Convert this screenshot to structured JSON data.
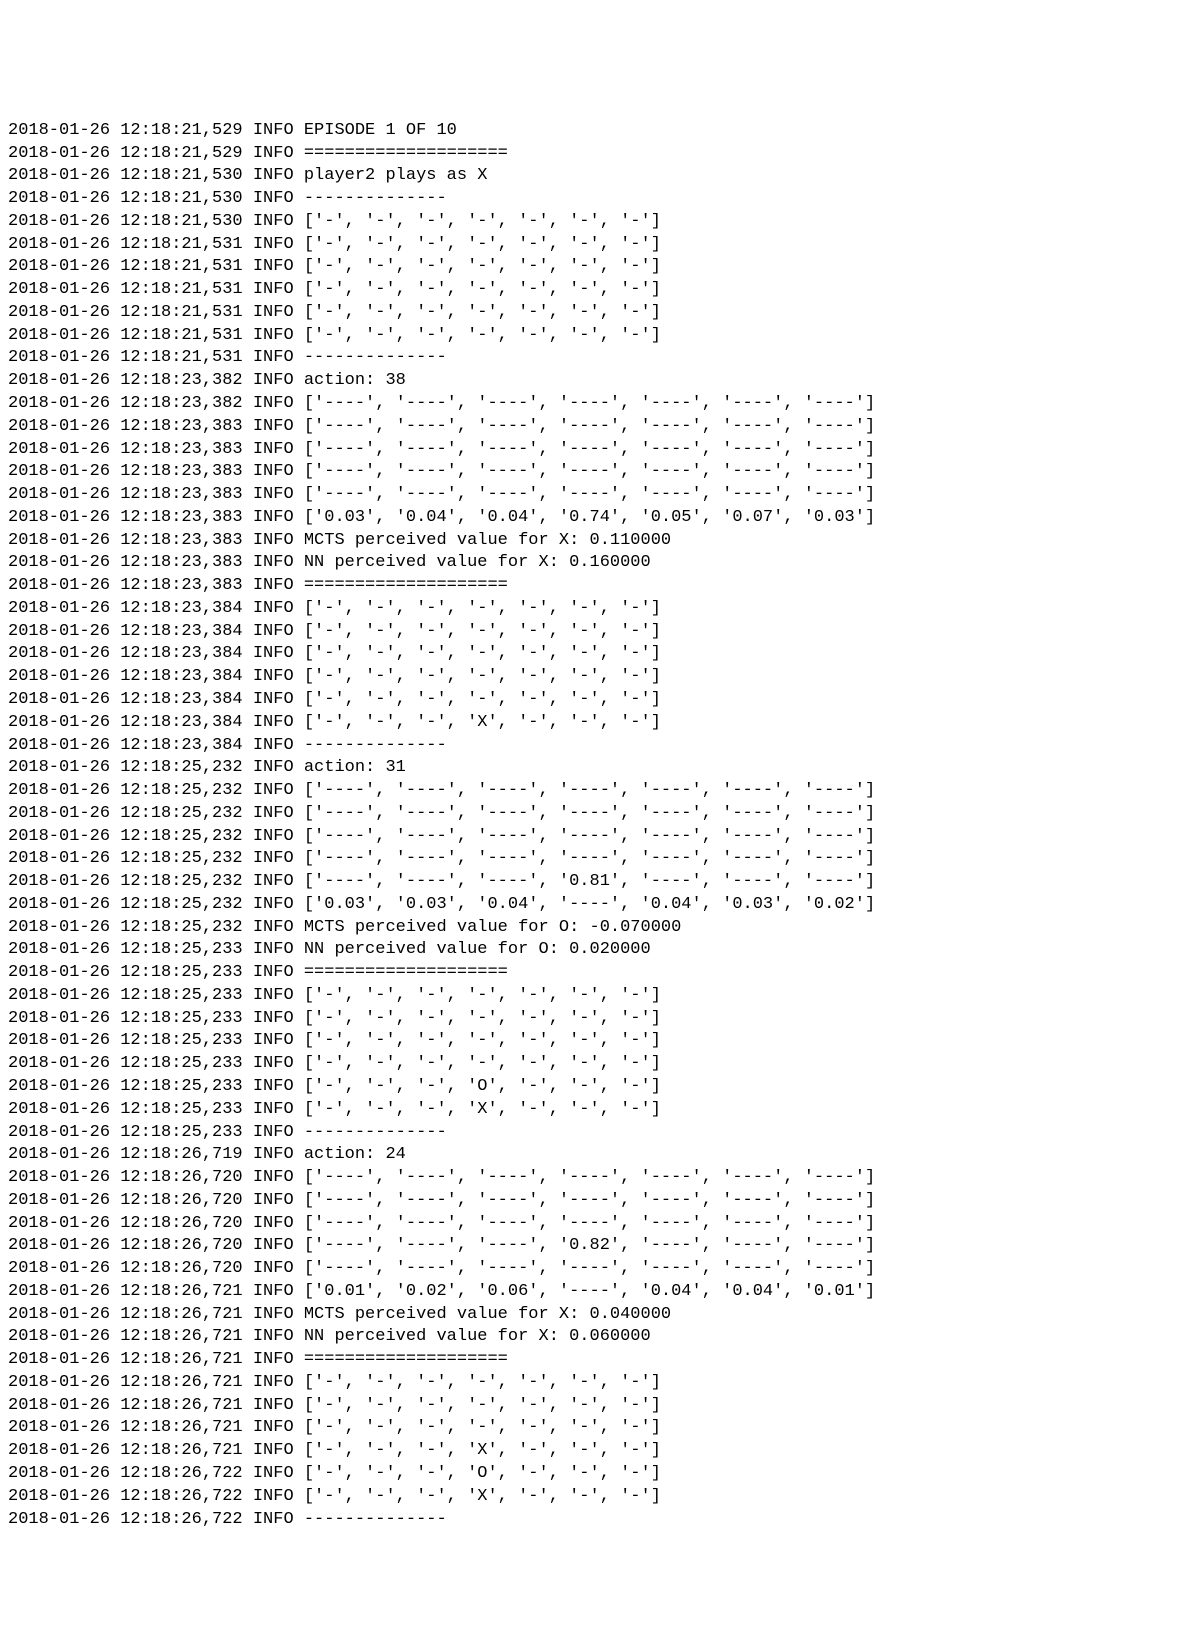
{
  "lines": [
    {
      "ts": "2018-01-26 12:18:21,529",
      "lvl": "INFO",
      "msg": "EPISODE 1 OF 10"
    },
    {
      "ts": "2018-01-26 12:18:21,529",
      "lvl": "INFO",
      "msg": "===================="
    },
    {
      "ts": "2018-01-26 12:18:21,530",
      "lvl": "INFO",
      "msg": "player2 plays as X"
    },
    {
      "ts": "2018-01-26 12:18:21,530",
      "lvl": "INFO",
      "msg": "--------------"
    },
    {
      "ts": "2018-01-26 12:18:21,530",
      "lvl": "INFO",
      "msg": "['-', '-', '-', '-', '-', '-', '-']"
    },
    {
      "ts": "2018-01-26 12:18:21,531",
      "lvl": "INFO",
      "msg": "['-', '-', '-', '-', '-', '-', '-']"
    },
    {
      "ts": "2018-01-26 12:18:21,531",
      "lvl": "INFO",
      "msg": "['-', '-', '-', '-', '-', '-', '-']"
    },
    {
      "ts": "2018-01-26 12:18:21,531",
      "lvl": "INFO",
      "msg": "['-', '-', '-', '-', '-', '-', '-']"
    },
    {
      "ts": "2018-01-26 12:18:21,531",
      "lvl": "INFO",
      "msg": "['-', '-', '-', '-', '-', '-', '-']"
    },
    {
      "ts": "2018-01-26 12:18:21,531",
      "lvl": "INFO",
      "msg": "['-', '-', '-', '-', '-', '-', '-']"
    },
    {
      "ts": "2018-01-26 12:18:21,531",
      "lvl": "INFO",
      "msg": "--------------"
    },
    {
      "ts": "2018-01-26 12:18:23,382",
      "lvl": "INFO",
      "msg": "action: 38"
    },
    {
      "ts": "2018-01-26 12:18:23,382",
      "lvl": "INFO",
      "msg": "['----', '----', '----', '----', '----', '----', '----']"
    },
    {
      "ts": "2018-01-26 12:18:23,383",
      "lvl": "INFO",
      "msg": "['----', '----', '----', '----', '----', '----', '----']"
    },
    {
      "ts": "2018-01-26 12:18:23,383",
      "lvl": "INFO",
      "msg": "['----', '----', '----', '----', '----', '----', '----']"
    },
    {
      "ts": "2018-01-26 12:18:23,383",
      "lvl": "INFO",
      "msg": "['----', '----', '----', '----', '----', '----', '----']"
    },
    {
      "ts": "2018-01-26 12:18:23,383",
      "lvl": "INFO",
      "msg": "['----', '----', '----', '----', '----', '----', '----']"
    },
    {
      "ts": "2018-01-26 12:18:23,383",
      "lvl": "INFO",
      "msg": "['0.03', '0.04', '0.04', '0.74', '0.05', '0.07', '0.03']"
    },
    {
      "ts": "2018-01-26 12:18:23,383",
      "lvl": "INFO",
      "msg": "MCTS perceived value for X: 0.110000"
    },
    {
      "ts": "2018-01-26 12:18:23,383",
      "lvl": "INFO",
      "msg": "NN perceived value for X: 0.160000"
    },
    {
      "ts": "2018-01-26 12:18:23,383",
      "lvl": "INFO",
      "msg": "===================="
    },
    {
      "ts": "2018-01-26 12:18:23,384",
      "lvl": "INFO",
      "msg": "['-', '-', '-', '-', '-', '-', '-']"
    },
    {
      "ts": "2018-01-26 12:18:23,384",
      "lvl": "INFO",
      "msg": "['-', '-', '-', '-', '-', '-', '-']"
    },
    {
      "ts": "2018-01-26 12:18:23,384",
      "lvl": "INFO",
      "msg": "['-', '-', '-', '-', '-', '-', '-']"
    },
    {
      "ts": "2018-01-26 12:18:23,384",
      "lvl": "INFO",
      "msg": "['-', '-', '-', '-', '-', '-', '-']"
    },
    {
      "ts": "2018-01-26 12:18:23,384",
      "lvl": "INFO",
      "msg": "['-', '-', '-', '-', '-', '-', '-']"
    },
    {
      "ts": "2018-01-26 12:18:23,384",
      "lvl": "INFO",
      "msg": "['-', '-', '-', 'X', '-', '-', '-']"
    },
    {
      "ts": "2018-01-26 12:18:23,384",
      "lvl": "INFO",
      "msg": "--------------"
    },
    {
      "ts": "2018-01-26 12:18:25,232",
      "lvl": "INFO",
      "msg": "action: 31"
    },
    {
      "ts": "2018-01-26 12:18:25,232",
      "lvl": "INFO",
      "msg": "['----', '----', '----', '----', '----', '----', '----']"
    },
    {
      "ts": "2018-01-26 12:18:25,232",
      "lvl": "INFO",
      "msg": "['----', '----', '----', '----', '----', '----', '----']"
    },
    {
      "ts": "2018-01-26 12:18:25,232",
      "lvl": "INFO",
      "msg": "['----', '----', '----', '----', '----', '----', '----']"
    },
    {
      "ts": "2018-01-26 12:18:25,232",
      "lvl": "INFO",
      "msg": "['----', '----', '----', '----', '----', '----', '----']"
    },
    {
      "ts": "2018-01-26 12:18:25,232",
      "lvl": "INFO",
      "msg": "['----', '----', '----', '0.81', '----', '----', '----']"
    },
    {
      "ts": "2018-01-26 12:18:25,232",
      "lvl": "INFO",
      "msg": "['0.03', '0.03', '0.04', '----', '0.04', '0.03', '0.02']"
    },
    {
      "ts": "2018-01-26 12:18:25,232",
      "lvl": "INFO",
      "msg": "MCTS perceived value for O: -0.070000"
    },
    {
      "ts": "2018-01-26 12:18:25,233",
      "lvl": "INFO",
      "msg": "NN perceived value for O: 0.020000"
    },
    {
      "ts": "2018-01-26 12:18:25,233",
      "lvl": "INFO",
      "msg": "===================="
    },
    {
      "ts": "2018-01-26 12:18:25,233",
      "lvl": "INFO",
      "msg": "['-', '-', '-', '-', '-', '-', '-']"
    },
    {
      "ts": "2018-01-26 12:18:25,233",
      "lvl": "INFO",
      "msg": "['-', '-', '-', '-', '-', '-', '-']"
    },
    {
      "ts": "2018-01-26 12:18:25,233",
      "lvl": "INFO",
      "msg": "['-', '-', '-', '-', '-', '-', '-']"
    },
    {
      "ts": "2018-01-26 12:18:25,233",
      "lvl": "INFO",
      "msg": "['-', '-', '-', '-', '-', '-', '-']"
    },
    {
      "ts": "2018-01-26 12:18:25,233",
      "lvl": "INFO",
      "msg": "['-', '-', '-', 'O', '-', '-', '-']"
    },
    {
      "ts": "2018-01-26 12:18:25,233",
      "lvl": "INFO",
      "msg": "['-', '-', '-', 'X', '-', '-', '-']"
    },
    {
      "ts": "2018-01-26 12:18:25,233",
      "lvl": "INFO",
      "msg": "--------------"
    },
    {
      "ts": "2018-01-26 12:18:26,719",
      "lvl": "INFO",
      "msg": "action: 24"
    },
    {
      "ts": "2018-01-26 12:18:26,720",
      "lvl": "INFO",
      "msg": "['----', '----', '----', '----', '----', '----', '----']"
    },
    {
      "ts": "2018-01-26 12:18:26,720",
      "lvl": "INFO",
      "msg": "['----', '----', '----', '----', '----', '----', '----']"
    },
    {
      "ts": "2018-01-26 12:18:26,720",
      "lvl": "INFO",
      "msg": "['----', '----', '----', '----', '----', '----', '----']"
    },
    {
      "ts": "2018-01-26 12:18:26,720",
      "lvl": "INFO",
      "msg": "['----', '----', '----', '0.82', '----', '----', '----']"
    },
    {
      "ts": "2018-01-26 12:18:26,720",
      "lvl": "INFO",
      "msg": "['----', '----', '----', '----', '----', '----', '----']"
    },
    {
      "ts": "2018-01-26 12:18:26,721",
      "lvl": "INFO",
      "msg": "['0.01', '0.02', '0.06', '----', '0.04', '0.04', '0.01']"
    },
    {
      "ts": "2018-01-26 12:18:26,721",
      "lvl": "INFO",
      "msg": "MCTS perceived value for X: 0.040000"
    },
    {
      "ts": "2018-01-26 12:18:26,721",
      "lvl": "INFO",
      "msg": "NN perceived value for X: 0.060000"
    },
    {
      "ts": "2018-01-26 12:18:26,721",
      "lvl": "INFO",
      "msg": "===================="
    },
    {
      "ts": "2018-01-26 12:18:26,721",
      "lvl": "INFO",
      "msg": "['-', '-', '-', '-', '-', '-', '-']"
    },
    {
      "ts": "2018-01-26 12:18:26,721",
      "lvl": "INFO",
      "msg": "['-', '-', '-', '-', '-', '-', '-']"
    },
    {
      "ts": "2018-01-26 12:18:26,721",
      "lvl": "INFO",
      "msg": "['-', '-', '-', '-', '-', '-', '-']"
    },
    {
      "ts": "2018-01-26 12:18:26,721",
      "lvl": "INFO",
      "msg": "['-', '-', '-', 'X', '-', '-', '-']"
    },
    {
      "ts": "2018-01-26 12:18:26,722",
      "lvl": "INFO",
      "msg": "['-', '-', '-', 'O', '-', '-', '-']"
    },
    {
      "ts": "2018-01-26 12:18:26,722",
      "lvl": "INFO",
      "msg": "['-', '-', '-', 'X', '-', '-', '-']"
    },
    {
      "ts": "2018-01-26 12:18:26,722",
      "lvl": "INFO",
      "msg": "--------------",
      "partial": true
    }
  ]
}
